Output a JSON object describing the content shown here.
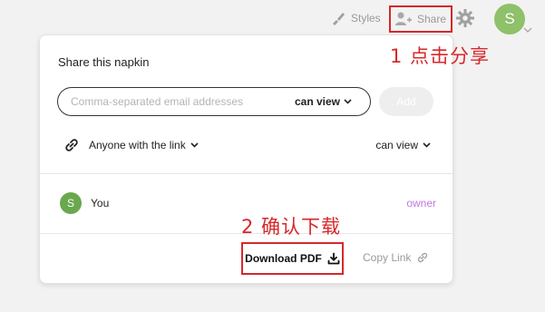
{
  "topbar": {
    "styles_label": "Styles",
    "share_label": "Share",
    "user_initial": "S"
  },
  "panel": {
    "title": "Share this napkin",
    "email": {
      "value": "",
      "placeholder": "Comma-separated email addresses",
      "permission": "can view"
    },
    "add_label": "Add",
    "link_access": {
      "label": "Anyone with the link",
      "permission": "can view"
    },
    "member": {
      "initial": "S",
      "name": "You",
      "role": "owner"
    },
    "download_label": "Download PDF",
    "copy_link_label": "Copy Link"
  },
  "annotations": {
    "step1": "1 点击分享",
    "step2": "2 确认下载"
  },
  "colors": {
    "highlight": "#d7282a",
    "avatar": "#8fc06a",
    "owner": "#c078e0"
  },
  "icons": [
    "brush-icon",
    "add-user-icon",
    "gear-icon",
    "chevron-down-icon",
    "link-icon",
    "download-icon"
  ]
}
